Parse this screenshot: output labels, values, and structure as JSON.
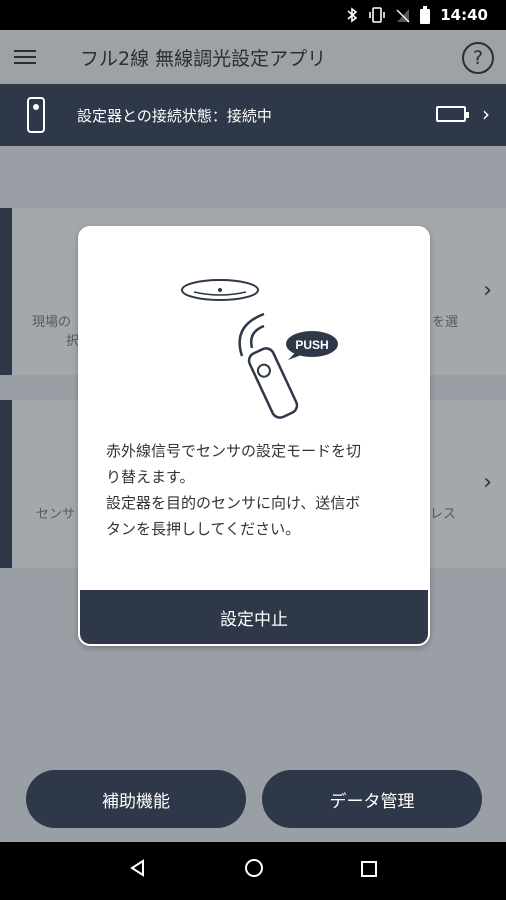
{
  "status_bar": {
    "time": "14:40"
  },
  "app_bar": {
    "title": "フル2線 無線調光設定アプリ",
    "help": "?"
  },
  "connection": {
    "label": "設定器との接続状態：接続中"
  },
  "cards": [
    {
      "text_left": "現場の",
      "text_left2": "択",
      "text_right": "を選"
    },
    {
      "text_left": "センサ",
      "text_right": "レス"
    }
  ],
  "dialog": {
    "push_label": "PUSH",
    "message_lines": [
      "赤外線信号でセンサの設定モードを切",
      "り替えます。",
      "設定器を目的のセンサに向け、送信ボ",
      "タンを長押ししてください。"
    ],
    "cancel_button": "設定中止"
  },
  "bottom": {
    "assist_button": "補助機能",
    "data_button": "データ管理"
  },
  "icons": {
    "menu": "hamburger-icon",
    "help": "help-icon",
    "device": "remote-device-icon",
    "battery": "battery-icon",
    "chevron": "chevron-right-icon"
  }
}
